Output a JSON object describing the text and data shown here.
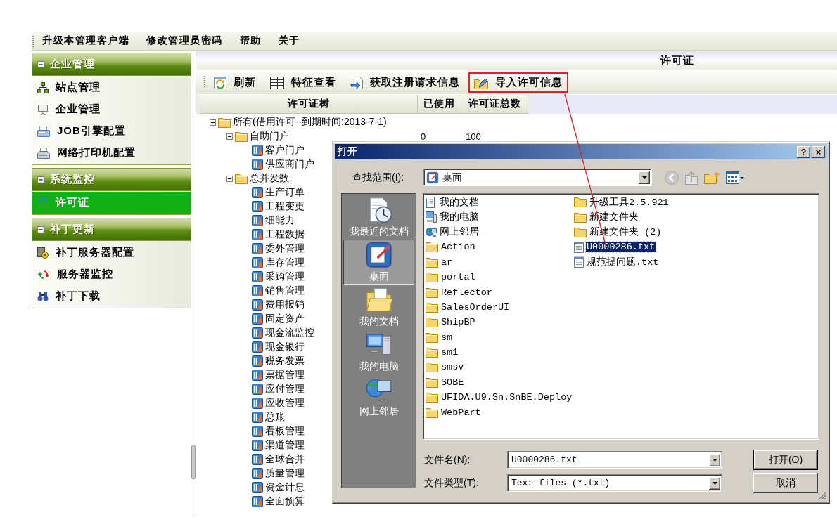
{
  "menu_bar": {
    "items": [
      "升级本管理客户端",
      "修改管理员密码",
      "帮助",
      "关于"
    ]
  },
  "sidebar": {
    "sections": [
      {
        "title": "企业管理",
        "expanded": true,
        "items": [
          {
            "label": "站点管理",
            "selected": false
          },
          {
            "label": "企业管理",
            "selected": false
          },
          {
            "label": "JOB引擎配置",
            "selected": false
          },
          {
            "label": "网络打印机配置",
            "selected": false
          }
        ]
      },
      {
        "title": "系统监控",
        "expanded": true,
        "items": [
          {
            "label": "许可证",
            "selected": true
          }
        ]
      },
      {
        "title": "补丁更新",
        "expanded": true,
        "items": [
          {
            "label": "补丁服务器配置",
            "selected": false
          },
          {
            "label": "服务器监控",
            "selected": false
          },
          {
            "label": "补丁下载",
            "selected": false
          }
        ]
      }
    ]
  },
  "panel": {
    "title": "许可证",
    "toolbar": [
      {
        "label": "刷新",
        "highlighted": false
      },
      {
        "label": "特征查看",
        "highlighted": false
      },
      {
        "label": "获取注册请求信息",
        "highlighted": false
      },
      {
        "label": "导入许可信息",
        "highlighted": true
      }
    ],
    "tree": {
      "columns": [
        "许可证树",
        "已使用",
        "许可证总数"
      ],
      "nodes": [
        {
          "label": "所有(借用许可--到期时间:2013-7-1)",
          "kind": "folder",
          "expanded": true,
          "children": [
            {
              "label": "自助门户",
              "kind": "folder",
              "expanded": true,
              "used": "0",
              "total": "100",
              "children": [
                {
                  "label": "客户门户",
                  "kind": "module"
                },
                {
                  "label": "供应商门户",
                  "kind": "module"
                }
              ]
            },
            {
              "label": "总并发数",
              "kind": "folder",
              "expanded": true,
              "children": [
                {
                  "label": "生产订单",
                  "kind": "module"
                },
                {
                  "label": "工程变更",
                  "kind": "module"
                },
                {
                  "label": "细能力",
                  "kind": "module"
                },
                {
                  "label": "工程数据",
                  "kind": "module"
                },
                {
                  "label": "委外管理",
                  "kind": "module"
                },
                {
                  "label": "库存管理",
                  "kind": "module"
                },
                {
                  "label": "采购管理",
                  "kind": "module"
                },
                {
                  "label": "销售管理",
                  "kind": "module"
                },
                {
                  "label": "费用报销",
                  "kind": "module"
                },
                {
                  "label": "固定资产",
                  "kind": "module"
                },
                {
                  "label": "现金流监控",
                  "kind": "module"
                },
                {
                  "label": "现金银行",
                  "kind": "module"
                },
                {
                  "label": "税务发票",
                  "kind": "module"
                },
                {
                  "label": "票据管理",
                  "kind": "module"
                },
                {
                  "label": "应付管理",
                  "kind": "module"
                },
                {
                  "label": "应收管理",
                  "kind": "module"
                },
                {
                  "label": "总账",
                  "kind": "module"
                },
                {
                  "label": "看板管理",
                  "kind": "module"
                },
                {
                  "label": "渠道管理",
                  "kind": "module"
                },
                {
                  "label": "全球合并",
                  "kind": "module"
                },
                {
                  "label": "质量管理",
                  "kind": "module"
                },
                {
                  "label": "资金计息",
                  "kind": "module"
                },
                {
                  "label": "全面预算",
                  "kind": "module"
                }
              ]
            }
          ]
        }
      ]
    }
  },
  "dialog": {
    "title": "打开",
    "title_buttons": [
      {
        "kind": "help",
        "label": "?"
      },
      {
        "kind": "close",
        "label": "×"
      }
    ],
    "look_in": {
      "label": "查找范围(I):",
      "value": "桌面"
    },
    "places": [
      {
        "label": "我最近的文档",
        "selected": false
      },
      {
        "label": "桌面",
        "selected": true
      },
      {
        "label": "我的文档",
        "selected": false
      },
      {
        "label": "我的电脑",
        "selected": false
      },
      {
        "label": "网上邻居",
        "selected": false
      }
    ],
    "files": [
      {
        "name": "我的文档",
        "kind": "documents",
        "selected": false
      },
      {
        "name": "我的电脑",
        "kind": "computer",
        "selected": false
      },
      {
        "name": "网上邻居",
        "kind": "network",
        "selected": false
      },
      {
        "name": "Action",
        "kind": "folder",
        "selected": false
      },
      {
        "name": "ar",
        "kind": "folder",
        "selected": false
      },
      {
        "name": "portal",
        "kind": "folder",
        "selected": false
      },
      {
        "name": "Reflector",
        "kind": "folder",
        "selected": false
      },
      {
        "name": "SalesOrderUI",
        "kind": "folder",
        "selected": false
      },
      {
        "name": "ShipBP",
        "kind": "folder",
        "selected": false
      },
      {
        "name": "sm",
        "kind": "folder",
        "selected": false
      },
      {
        "name": "sm1",
        "kind": "folder",
        "selected": false
      },
      {
        "name": "smsv",
        "kind": "folder",
        "selected": false
      },
      {
        "name": "SOBE",
        "kind": "folder",
        "selected": false
      },
      {
        "name": "UFIDA.U9.Sn.SnBE.Deploy",
        "kind": "folder",
        "selected": false
      },
      {
        "name": "WebPart",
        "kind": "folder",
        "selected": false
      },
      {
        "name": "升级工具2.5.921",
        "kind": "folder",
        "selected": false
      },
      {
        "name": "新建文件夹",
        "kind": "folder",
        "selected": false
      },
      {
        "name": "新建文件夹 (2)",
        "kind": "folder",
        "selected": false
      },
      {
        "name": "U0000286.txt",
        "kind": "text",
        "selected": true
      },
      {
        "name": "规范提问题.txt",
        "kind": "text",
        "selected": false
      }
    ],
    "file_name": {
      "label": "文件名(N):",
      "value": "U0000286.txt"
    },
    "file_type": {
      "label": "文件类型(T):",
      "value": "Text files (*.txt)"
    },
    "buttons": [
      "打开(O)",
      "取消"
    ]
  }
}
